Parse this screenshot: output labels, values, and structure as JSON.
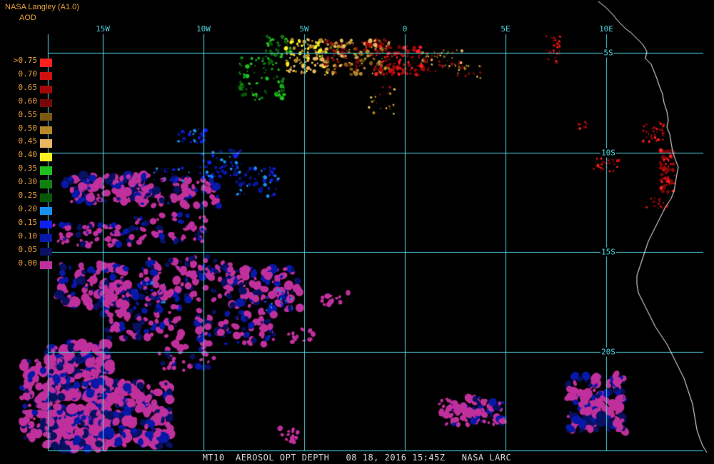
{
  "header": {
    "product": "NASA Langley (A1.0)",
    "parameter": "AOD"
  },
  "legend": {
    "items": [
      {
        "label": ">0.75",
        "color": "#ff2020"
      },
      {
        "label": "0.70",
        "color": "#d01010"
      },
      {
        "label": "0.65",
        "color": "#a00808"
      },
      {
        "label": "0.60",
        "color": "#780808"
      },
      {
        "label": "0.55",
        "color": "#7a5a10"
      },
      {
        "label": "0.50",
        "color": "#b88828"
      },
      {
        "label": "0.45",
        "color": "#e8b860"
      },
      {
        "label": "0.40",
        "color": "#f8f020"
      },
      {
        "label": "0.35",
        "color": "#20c020"
      },
      {
        "label": "0.30",
        "color": "#108010"
      },
      {
        "label": "0.25",
        "color": "#085808"
      },
      {
        "label": "0.20",
        "color": "#1890f0"
      },
      {
        "label": "0.15",
        "color": "#1020f0"
      },
      {
        "label": "0.10",
        "color": "#0818a8"
      },
      {
        "label": "0.05",
        "color": "#081060"
      },
      {
        "label": "0.00",
        "color": "#c0309c"
      }
    ]
  },
  "grid": {
    "longitudes": [
      {
        "label": "15W",
        "value": -15
      },
      {
        "label": "10W",
        "value": -10
      },
      {
        "label": "5W",
        "value": -5
      },
      {
        "label": "0",
        "value": 0
      },
      {
        "label": "5E",
        "value": 5
      },
      {
        "label": "10E",
        "value": 10
      }
    ],
    "latitudes": [
      {
        "label": "5S",
        "value": -5
      },
      {
        "label": "10S",
        "value": -10
      },
      {
        "label": "15S",
        "value": -15
      },
      {
        "label": "20S",
        "value": -20
      }
    ],
    "color": "#4fd6e0"
  },
  "footer": {
    "text": "MT10  AEROSOL OPT DEPTH   08 18, 2016 15:45Z   NASA LARC"
  },
  "colors": {
    "background": "#000000",
    "coastline": "#ffffff",
    "label": "#e8a040"
  }
}
